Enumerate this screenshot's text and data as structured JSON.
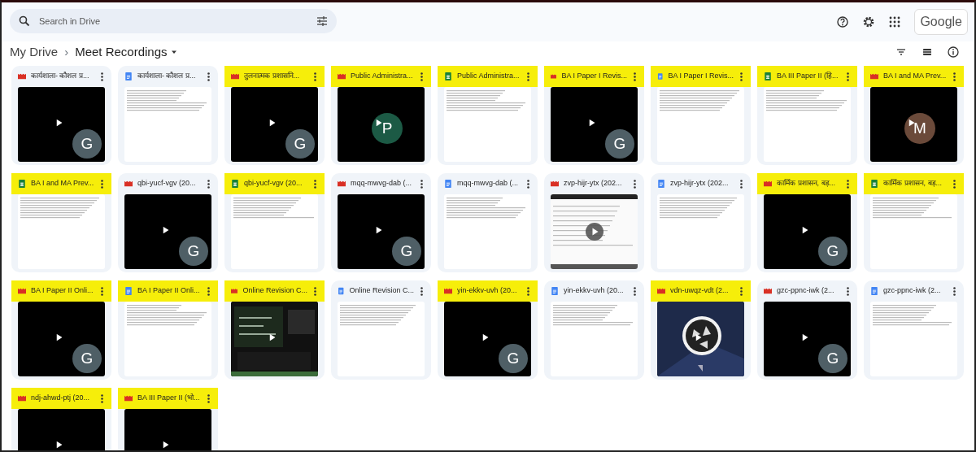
{
  "search": {
    "placeholder": "Search in Drive"
  },
  "brand": "Google",
  "breadcrumb": [
    "My Drive",
    "Meet Recordings"
  ],
  "breadcrumb_separator": "›",
  "files": [
    {
      "kind": "video",
      "title": "कार्यशाला- कौशल प्र...",
      "highlighted": false,
      "thumbnail": {
        "kind": "avatar",
        "avatar": "G",
        "color": "#4f5f66"
      }
    },
    {
      "kind": "doc",
      "title": "कार्यशाला- कौशल प्र...",
      "highlighted": false,
      "thumbnail": {
        "kind": "doc"
      }
    },
    {
      "kind": "video",
      "title": "तुलनात्मक प्रशासनि...",
      "highlighted": true,
      "thumbnail": {
        "kind": "avatar",
        "avatar": "G",
        "color": "#4f5f66"
      }
    },
    {
      "kind": "video",
      "title": "Public Administra...",
      "highlighted": true,
      "thumbnail": {
        "kind": "avatar",
        "avatar": "P",
        "color": "#1c5a45"
      }
    },
    {
      "kind": "sheet",
      "title": "Public Administra...",
      "highlighted": true,
      "thumbnail": {
        "kind": "doc"
      }
    },
    {
      "kind": "video",
      "title": "BA I Paper I Revis...",
      "highlighted": true,
      "thumbnail": {
        "kind": "avatar",
        "avatar": "G",
        "color": "#4f5f66"
      }
    },
    {
      "kind": "doc",
      "title": "BA I Paper I Revis...",
      "highlighted": true,
      "thumbnail": {
        "kind": "doc"
      }
    },
    {
      "kind": "sheet",
      "title": "BA III Paper II (हि...",
      "highlighted": true,
      "thumbnail": {
        "kind": "doc"
      }
    },
    {
      "kind": "video",
      "title": "BA I and MA Prev...",
      "highlighted": true,
      "thumbnail": {
        "kind": "avatar",
        "avatar": "M",
        "color": "#6b4a3a"
      }
    },
    {
      "kind": "sheet",
      "title": "BA I and MA Prev...",
      "highlighted": true,
      "thumbnail": {
        "kind": "doc"
      }
    },
    {
      "kind": "video",
      "title": "qbi-yucf-vgv (20...",
      "highlighted": false,
      "thumbnail": {
        "kind": "avatar",
        "avatar": "G",
        "color": "#4f5f66"
      }
    },
    {
      "kind": "sheet",
      "title": "qbi-yucf-vgv (20...",
      "highlighted": true,
      "thumbnail": {
        "kind": "doc"
      }
    },
    {
      "kind": "video",
      "title": "mqq-mwvg-dab (...",
      "highlighted": false,
      "thumbnail": {
        "kind": "avatar",
        "avatar": "G",
        "color": "#4f5f66"
      }
    },
    {
      "kind": "doc",
      "title": "mqq-mwvg-dab (...",
      "highlighted": false,
      "thumbnail": {
        "kind": "doc"
      }
    },
    {
      "kind": "video",
      "title": "zvp-hijr-ytx (202...",
      "highlighted": false,
      "thumbnail": {
        "kind": "screen-doc"
      }
    },
    {
      "kind": "doc",
      "title": "zvp-hijr-ytx (202...",
      "highlighted": false,
      "thumbnail": {
        "kind": "doc"
      }
    },
    {
      "kind": "video",
      "title": "कार्मिक प्रशासन, बड़...",
      "highlighted": true,
      "thumbnail": {
        "kind": "avatar",
        "avatar": "G",
        "color": "#4f5f66"
      }
    },
    {
      "kind": "sheet",
      "title": "कार्मिक प्रशासन, बड़...",
      "highlighted": true,
      "thumbnail": {
        "kind": "doc"
      }
    },
    {
      "kind": "video",
      "title": "BA I Paper II Onli...",
      "highlighted": true,
      "thumbnail": {
        "kind": "avatar",
        "avatar": "G",
        "color": "#4f5f66"
      }
    },
    {
      "kind": "doc",
      "title": "BA I Paper II Onli...",
      "highlighted": true,
      "thumbnail": {
        "kind": "doc"
      }
    },
    {
      "kind": "video",
      "title": "Online Revision C...",
      "highlighted": true,
      "thumbnail": {
        "kind": "screen-dark"
      }
    },
    {
      "kind": "doc",
      "title": "Online Revision C...",
      "highlighted": false,
      "thumbnail": {
        "kind": "doc"
      }
    },
    {
      "kind": "video",
      "title": "yin-ekkv-uvh (20...",
      "highlighted": true,
      "thumbnail": {
        "kind": "avatar",
        "avatar": "G",
        "color": "#4f5f66"
      }
    },
    {
      "kind": "doc",
      "title": "yin-ekkv-uvh (20...",
      "highlighted": false,
      "thumbnail": {
        "kind": "doc"
      }
    },
    {
      "kind": "video",
      "title": "vdn-uwqz-vdt (2...",
      "highlighted": true,
      "thumbnail": {
        "kind": "screen-logo"
      }
    },
    {
      "kind": "video",
      "title": "gzc-ppnc-iwk (2...",
      "highlighted": false,
      "thumbnail": {
        "kind": "avatar",
        "avatar": "G",
        "color": "#4f5f66"
      }
    },
    {
      "kind": "doc",
      "title": "gzc-ppnc-iwk (2...",
      "highlighted": false,
      "thumbnail": {
        "kind": "doc"
      }
    },
    {
      "kind": "video",
      "title": "ndj-ahwd-ptj (20...",
      "highlighted": true,
      "thumbnail": {
        "kind": "avatar"
      }
    },
    {
      "kind": "video",
      "title": "BA III Paper II (भो...",
      "highlighted": true,
      "thumbnail": {
        "kind": "avatar"
      }
    }
  ]
}
